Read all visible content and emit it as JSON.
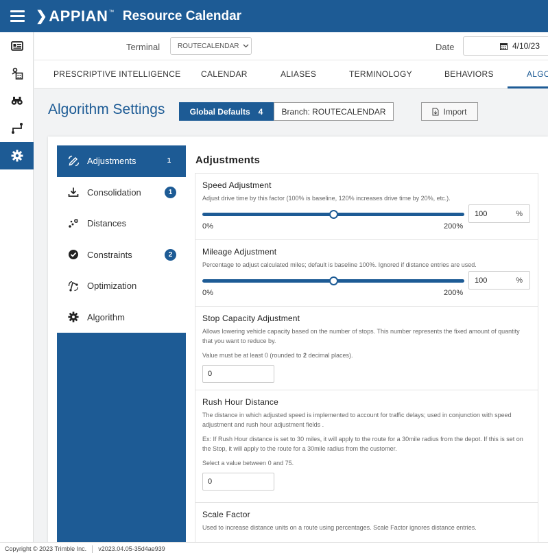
{
  "header": {
    "logo": "APPIAN",
    "trademark": "™",
    "title": "Resource Calendar"
  },
  "sidenav": {
    "icons": [
      "id-card-icon",
      "calendar-settings-icon",
      "binoculars-icon",
      "route-icon",
      "gear-icon"
    ],
    "active_index": 4
  },
  "filters": {
    "terminal_label": "Terminal",
    "terminal_value": "ROUTECALENDAR",
    "date_label": "Date",
    "date_value": "4/10/23"
  },
  "tabs": [
    {
      "label": "PRESCRIPTIVE INTELLIGENCE"
    },
    {
      "label": "CALENDAR"
    },
    {
      "label": "ALIASES"
    },
    {
      "label": "TERMINOLOGY"
    },
    {
      "label": "BEHAVIORS"
    },
    {
      "label": "ALGO"
    }
  ],
  "page": {
    "title": "Algorithm Settings",
    "global_defaults_label": "Global Defaults",
    "global_defaults_count": "4",
    "branch_label": "Branch: ROUTECALENDAR",
    "import_label": "Import"
  },
  "leftnav": [
    {
      "label": "Adjustments",
      "badge": "1",
      "icon": "pen-arrows-icon"
    },
    {
      "label": "Consolidation",
      "badge": "1",
      "icon": "download-icon"
    },
    {
      "label": "Distances",
      "badge": "",
      "icon": "scatter-points-icon"
    },
    {
      "label": "Constraints",
      "badge": "2",
      "icon": "check-circle-icon"
    },
    {
      "label": "Optimization",
      "badge": "",
      "icon": "optimize-route-icon"
    },
    {
      "label": "Algorithm",
      "badge": "",
      "icon": "gear-icon"
    }
  ],
  "content": {
    "title": "Adjustments",
    "speed": {
      "title": "Speed Adjustment",
      "desc": "Adjust drive time by this factor (100% is baseline, 120% increases drive time by 20%, etc.).",
      "min": "0%",
      "max": "200%",
      "value": "100",
      "unit": "%",
      "level": 0.5
    },
    "mileage": {
      "title": "Mileage Adjustment",
      "desc": "Percentage to adjust calculated miles; default is baseline 100%. Ignored if distance entries are used.",
      "min": "0%",
      "max": "200%",
      "value": "100",
      "unit": "%",
      "level": 0.5
    },
    "stop_capacity": {
      "title": "Stop Capacity Adjustment",
      "desc": "Allows lowering vehicle capacity based on the number of stops. This number represents the fixed amount of quantity that you want to reduce by.",
      "hint_prefix": "Value must be at least 0 (rounded to ",
      "hint_bold": "2",
      "hint_suffix": " decimal places).",
      "value": "0"
    },
    "rush_hour": {
      "title": "Rush Hour Distance",
      "desc": "The distance in which adjusted speed is implemented to account for traffic delays; used in conjunction with speed adjustment and rush hour adjustment fields .",
      "example": "Ex: If Rush Hour distance is set to 30 miles, it will apply to the route for a 30mile radius from the depot. If this is set on the Stop, it will apply to the route for a 30mile radius from the customer.",
      "hint": "Select a value between 0 and 75.",
      "value": "0"
    },
    "scale_factor": {
      "title": "Scale Factor",
      "desc": "Used to increase distance units on a route using percentages. Scale Factor ignores distance entries."
    }
  },
  "footer": {
    "copyright": "Copyright © 2023 Trimble Inc.",
    "version": "v2023.04.05-35d4ae939"
  }
}
